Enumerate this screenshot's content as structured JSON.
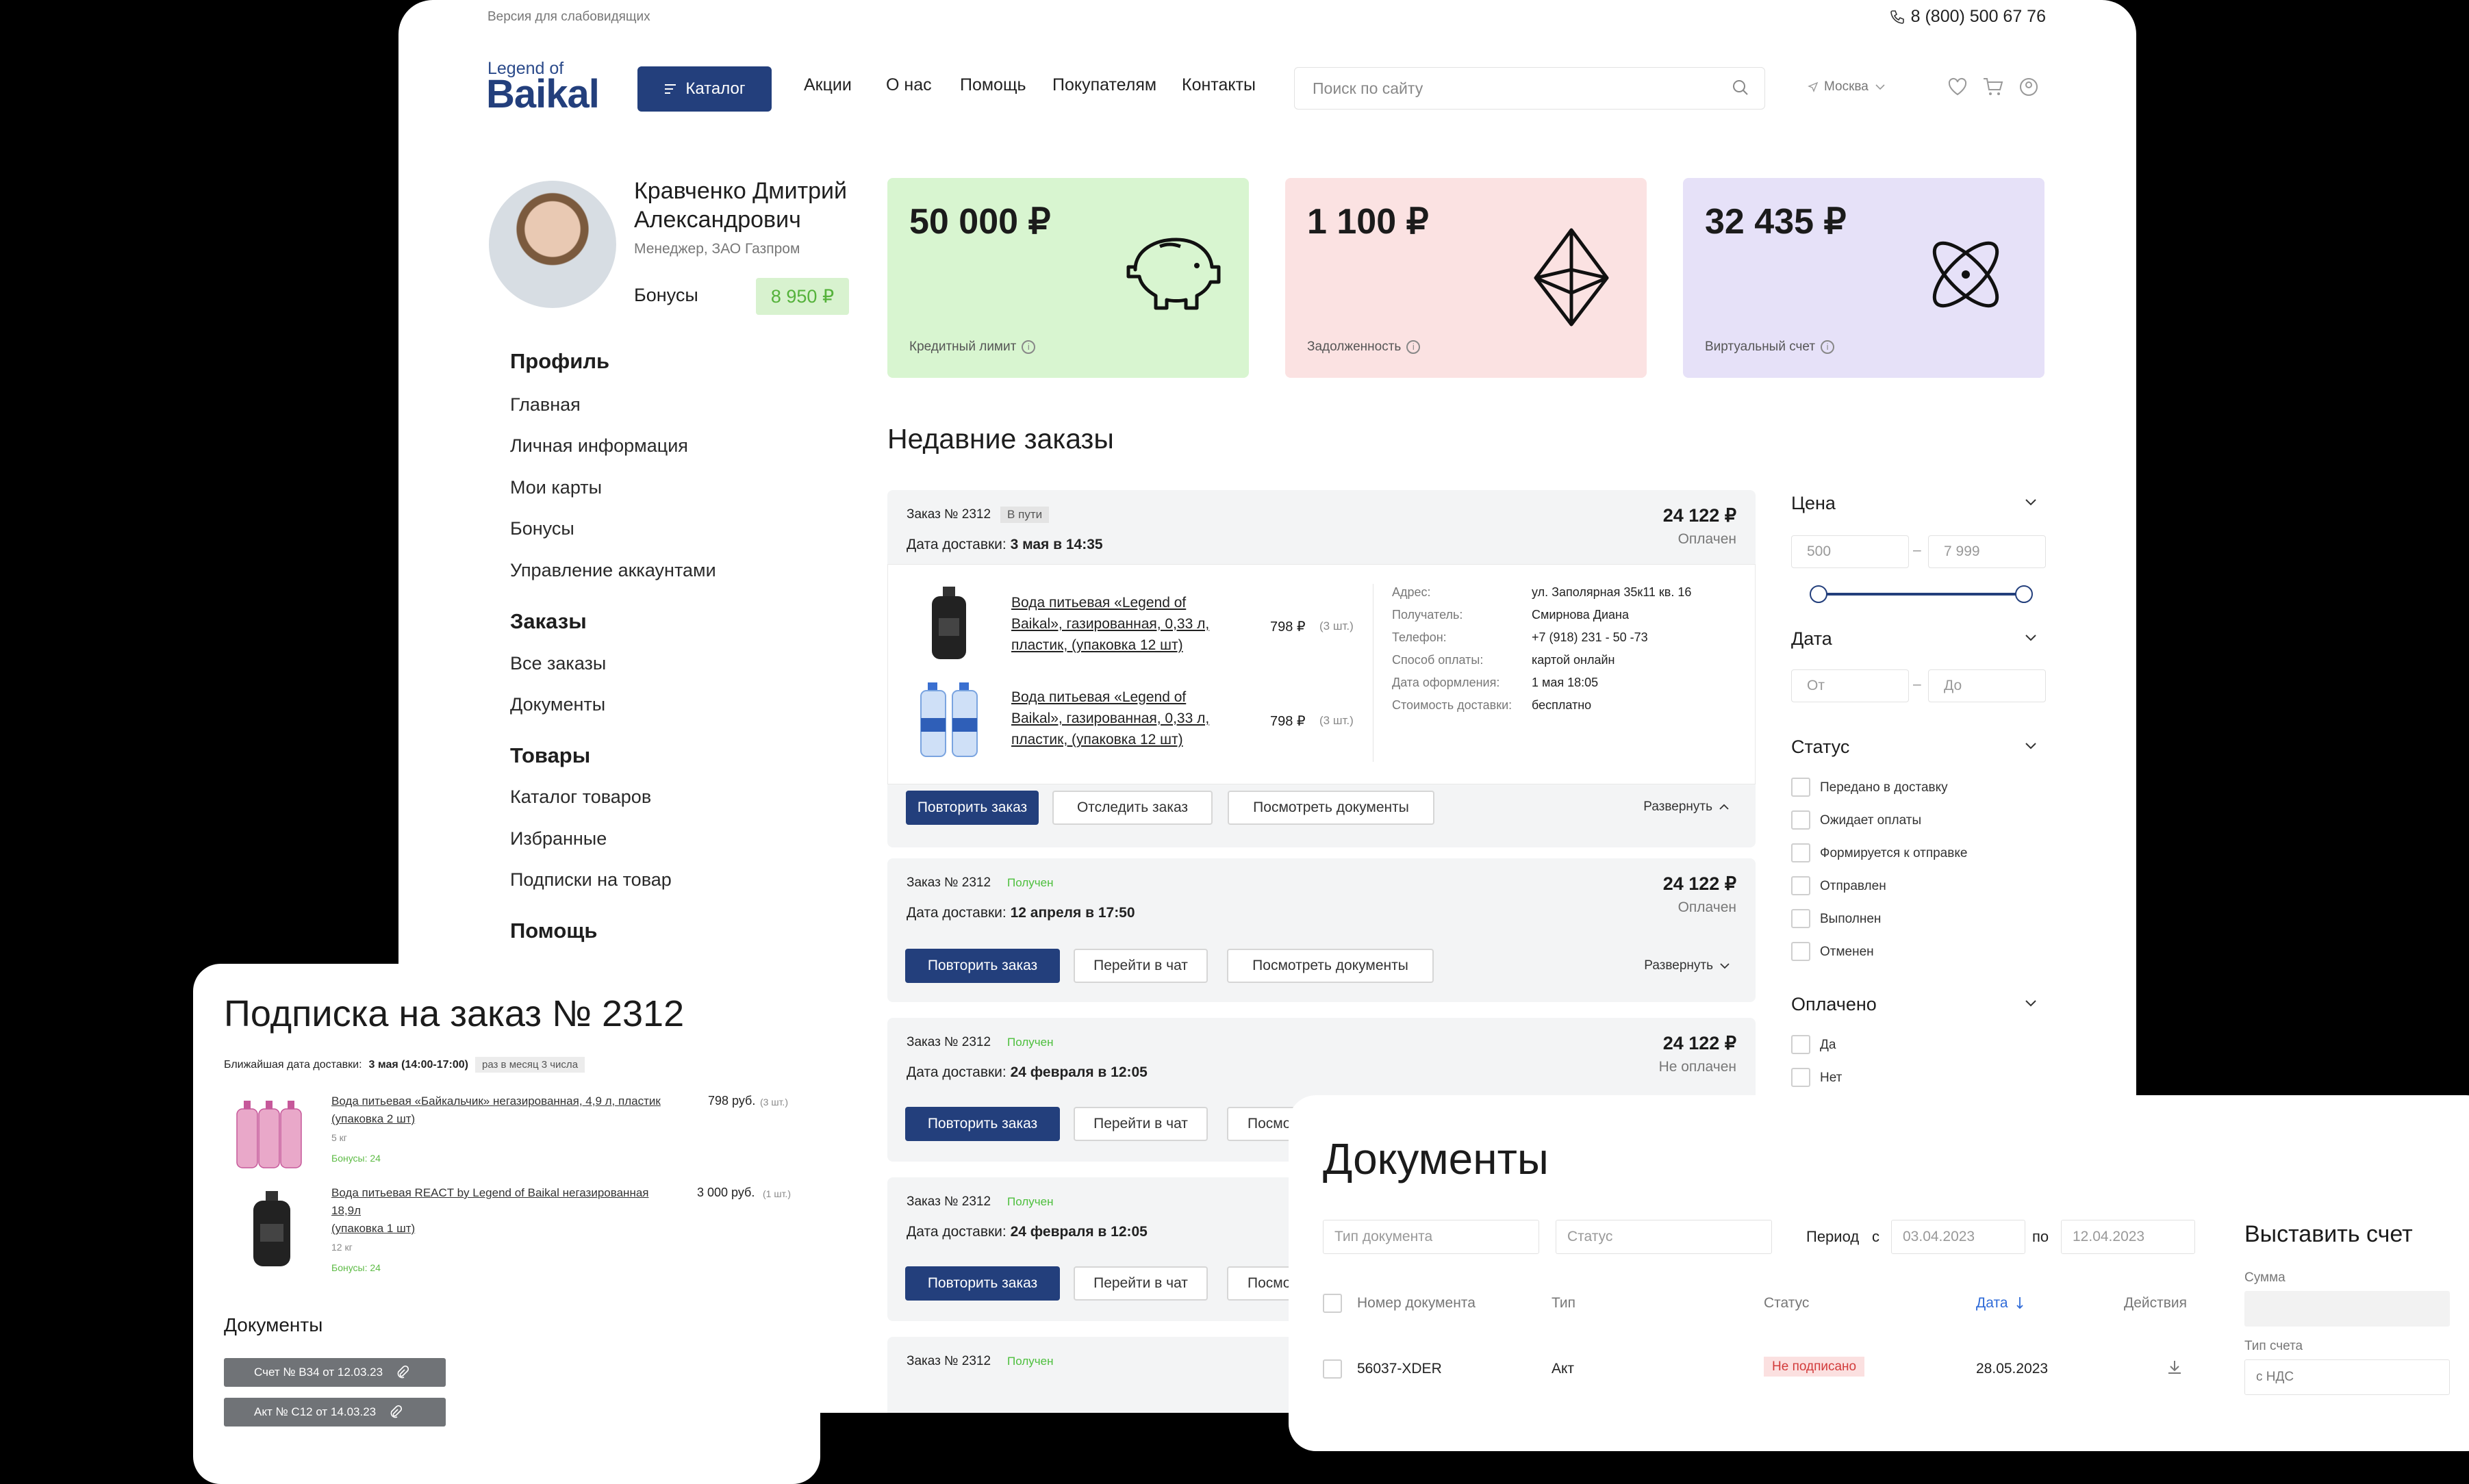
{
  "topbar": {
    "accessibility": "Версия для слабовидящих",
    "phone": "8 (800) 500 67 76"
  },
  "header": {
    "logo_small": "Legend of",
    "logo_big": "Baikal",
    "catalog_button": "Каталог",
    "nav": [
      "Акции",
      "О нас",
      "Помощь",
      "Покупателям",
      "Контакты"
    ],
    "search_placeholder": "Поиск по сайту",
    "city": "Москва"
  },
  "user": {
    "name_line1": "Кравченко Дмитрий",
    "name_line2": "Александрович",
    "role": "Менеджер, ЗАО Газпром",
    "bonus_label": "Бонусы",
    "bonus_value": "8 950 ₽"
  },
  "sidebar": {
    "profile": {
      "title": "Профиль",
      "items": [
        "Главная",
        "Личная информация",
        "Мои карты",
        "Бонусы",
        "Управление аккаунтами"
      ]
    },
    "orders": {
      "title": "Заказы",
      "items": [
        "Все заказы",
        "Документы"
      ]
    },
    "goods": {
      "title": "Товары",
      "items": [
        "Каталог товаров",
        "Избранные",
        "Подписки на товар"
      ]
    },
    "help": {
      "title": "Помощь"
    }
  },
  "stats": [
    {
      "value": "50 000 ₽",
      "label": "Кредитный лимит",
      "color": "#d8f5d0",
      "icon": "piggy-bank-icon"
    },
    {
      "value": "1 100 ₽",
      "label": "Задолженность",
      "color": "#fbe2e2",
      "icon": "crystal-icon"
    },
    {
      "value": "32 435 ₽",
      "label": "Виртуальный счет",
      "color": "#e6e1f8",
      "icon": "atom-icon"
    }
  ],
  "recent_title": "Недавние заказы",
  "orders": [
    {
      "number": "Заказ № 2312",
      "status": "В пути",
      "delivery_label": "Дата доставки:",
      "delivery": "3 мая в 14:35",
      "sum": "24 122 ₽",
      "paid": "Оплачен",
      "products": [
        {
          "name_l1": "Вода питьевая «Legend of",
          "name_l2": "Baikal», газированная, 0,33 л,",
          "name_l3": "пластик, (упаковка 12 шт)",
          "price": "798 ₽",
          "qty": "(3 шт.)"
        },
        {
          "name_l1": "Вода питьевая «Legend of",
          "name_l2": "Baikal», газированная, 0,33 л,",
          "name_l3": "пластик, (упаковка 12 шт)",
          "price": "798 ₽",
          "qty": "(3 шт.)"
        }
      ],
      "details": [
        {
          "k": "Адрес:",
          "v": "ул. Заполярная 35к11 кв. 16"
        },
        {
          "k": "Получатель:",
          "v": "Смирнова Диана"
        },
        {
          "k": "Телефон:",
          "v": "+7 (918) 231 - 50 -73"
        },
        {
          "k": "Способ оплаты:",
          "v": "картой онлайн"
        },
        {
          "k": "Дата оформления:",
          "v": "1 мая 18:05"
        },
        {
          "k": "Стоимость доставки:",
          "v": "бесплатно"
        }
      ],
      "buttons": [
        "Повторить заказ",
        "Отследить заказ",
        "Посмотреть документы"
      ],
      "expand": "Развернуть"
    },
    {
      "number": "Заказ № 2312",
      "status": "Получен",
      "delivery_label": "Дата доставки:",
      "delivery": "12 апреля в 17:50",
      "sum": "24 122 ₽",
      "paid": "Оплачен",
      "buttons": [
        "Повторить заказ",
        "Перейти в чат",
        "Посмотреть документы"
      ],
      "expand": "Развернуть"
    },
    {
      "number": "Заказ № 2312",
      "status": "Получен",
      "delivery_label": "Дата доставки:",
      "delivery": "24 февраля в 12:05",
      "sum": "24 122 ₽",
      "paid": "Не оплачен",
      "buttons": [
        "Повторить заказ",
        "Перейти в чат",
        "Посмо"
      ]
    },
    {
      "number": "Заказ № 2312",
      "status": "Получен",
      "delivery_label": "Дата доставки:",
      "delivery": "24 февраля в 12:05",
      "buttons": [
        "Повторить заказ",
        "Перейти в чат",
        "Посмо"
      ]
    },
    {
      "number": "Заказ № 2312",
      "status": "Получен"
    }
  ],
  "filters": {
    "price": {
      "title": "Цена",
      "from": "500",
      "to": "7 999",
      "range_min": 0,
      "range_max": 1
    },
    "date": {
      "title": "Дата",
      "from_ph": "От",
      "to_ph": "До"
    },
    "status": {
      "title": "Статус",
      "options": [
        "Передано в доставку",
        "Ожидает оплаты",
        "Формируется к отправке",
        "Отправлен",
        "Выполнен",
        "Отменен"
      ]
    },
    "paid": {
      "title": "Оплачено",
      "options": [
        "Да",
        "Нет"
      ]
    }
  },
  "subscription": {
    "title": "Подписка на заказ № 2312",
    "near_label": "Ближайшая дата доставки:",
    "near_value": "3 мая (14:00-17:00)",
    "frequency": "раз в месяц 3 числа",
    "items": [
      {
        "name_l1": "Вода питьевая «Байкальчик» негазированная, 4,9 л, пластик",
        "name_l2": "(упаковка 2 шт)",
        "weight": "5 кг",
        "bonus": "Бонусы: 24",
        "price": "798 руб.",
        "qty": "(3 шт.)"
      },
      {
        "name_l1": "Вода питьевая REACT by Legend of Baikal негазированная",
        "name_l2": "18,9л",
        "name_l3": "(упаковка 1 шт)",
        "weight": "12 кг",
        "bonus": "Бонусы: 24",
        "price": "3 000 руб.",
        "qty": "(1 шт.)"
      }
    ],
    "docs_title": "Документы",
    "docs": [
      "Счет № В34 от 12.03.23",
      "Акт № С12 от 14.03.23"
    ]
  },
  "documents": {
    "title": "Документы",
    "type_ph": "Тип документа",
    "status_ph": "Статус",
    "period_label": "Период",
    "from_label": "с",
    "from_value": "03.04.2023",
    "to_label": "по",
    "to_value": "12.04.2023",
    "columns": [
      "Номер документа",
      "Тип",
      "Статус",
      "Дата",
      "Действия"
    ],
    "rows": [
      {
        "number": "56037-XDER",
        "type": "Акт",
        "status": "Не подписано",
        "date": "28.05.2023"
      }
    ],
    "invoice": {
      "title": "Выставить счет",
      "sum_label": "Сумма",
      "type_label": "Тип счета",
      "type_value": "с НДС"
    }
  }
}
